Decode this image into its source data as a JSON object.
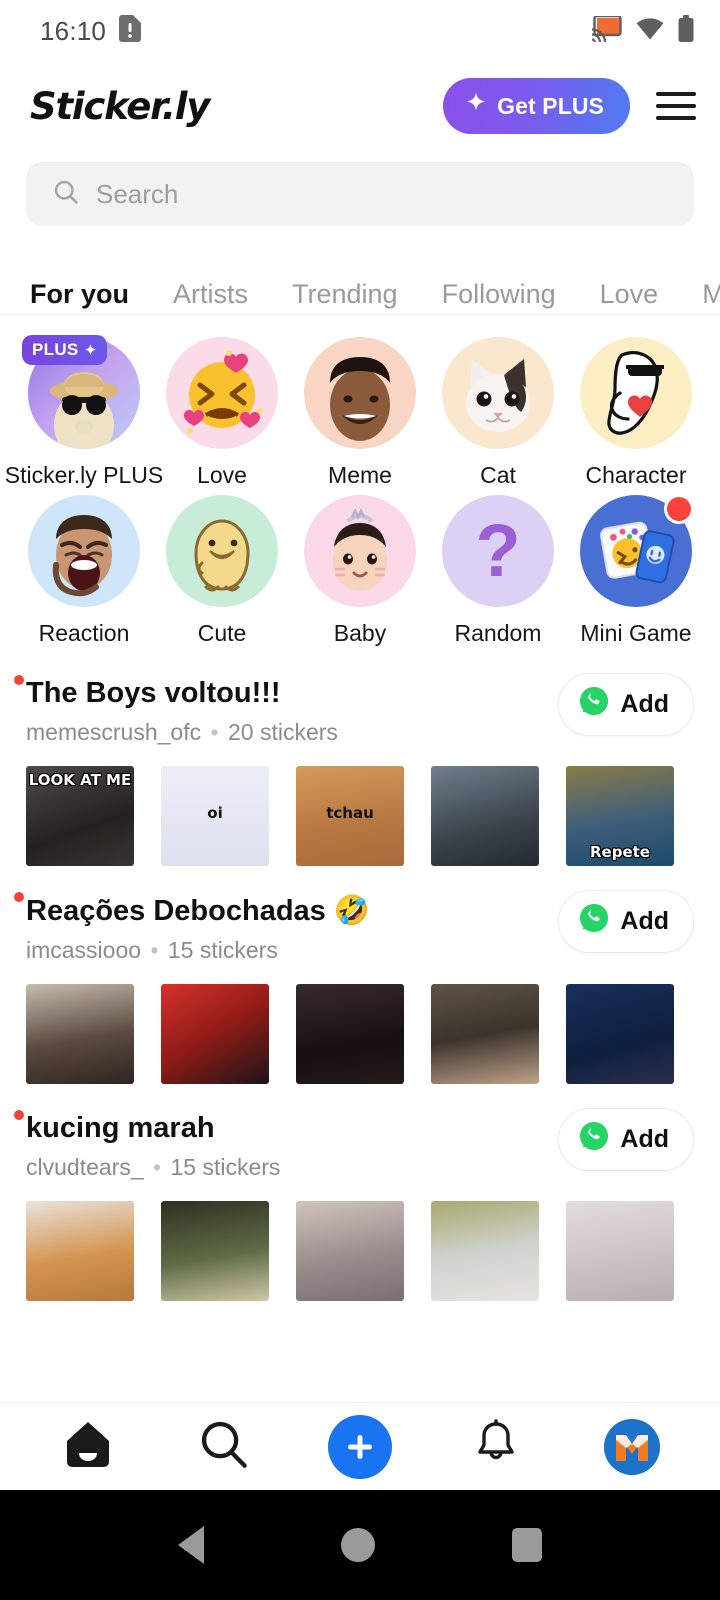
{
  "status_bar": {
    "time": "16:10",
    "icons": [
      "sim-alert-icon",
      "cast-icon",
      "wifi-icon",
      "battery-icon"
    ]
  },
  "header": {
    "brand": "Sticker.ly",
    "plus_button_label": "Get PLUS",
    "menu_icon": "hamburger-menu-icon"
  },
  "search": {
    "placeholder": "Search",
    "value": "",
    "icon": "search-icon"
  },
  "tabs": [
    {
      "label": "For you",
      "active": true
    },
    {
      "label": "Artists",
      "active": false
    },
    {
      "label": "Trending",
      "active": false
    },
    {
      "label": "Following",
      "active": false
    },
    {
      "label": "Love",
      "active": false
    },
    {
      "label": "Mem",
      "active": false
    }
  ],
  "categories": [
    {
      "label": "Sticker.ly PLUS",
      "badge": "PLUS",
      "bg": "#b9a4ef",
      "icon": "dog-sunglasses-hat-icon"
    },
    {
      "label": "Love",
      "bg": "#fbdbe8",
      "icon": "smiling-hearts-emoji",
      "glyph": "😖"
    },
    {
      "label": "Meme",
      "bg": "#f9d6c4",
      "icon": "smiling-man-meme-icon"
    },
    {
      "label": "Cat",
      "bg": "#fbe6ce",
      "icon": "cat-face-icon"
    },
    {
      "label": "Character",
      "bg": "#fbeec2",
      "icon": "flork-heart-character-icon"
    },
    {
      "label": "Reaction",
      "bg": "#cfe6fa",
      "icon": "screaming-man-icon"
    },
    {
      "label": "Cute",
      "bg": "#c7edd8",
      "icon": "duck-character-icon"
    },
    {
      "label": "Baby",
      "bg": "#fbd8e6",
      "icon": "baby-face-icon"
    },
    {
      "label": "Random",
      "bg": "#ddd0f5",
      "icon": "question-mark-icon",
      "glyph": "?"
    },
    {
      "label": "Mini Game",
      "bg": "#4a6fd4",
      "icon": "mini-game-cards-icon",
      "notification": true
    }
  ],
  "packs": [
    {
      "title": "The Boys voltou!!!",
      "emoji": "",
      "author": "memescrush_ofc",
      "count": "20 stickers",
      "separator": "•",
      "add_label": "Add",
      "add_icon": "whatsapp-icon",
      "is_new": true,
      "thumbs": [
        {
          "caption": "LOOK AT ME",
          "caption_pos": "top",
          "bg": "linear-gradient(160deg,#4d4b47,#232221 60%,#3a3430)"
        },
        {
          "caption": "oi",
          "caption_pos": "mid",
          "bg": "linear-gradient(180deg,#eceef7,#dde1ef)"
        },
        {
          "caption": "tchau",
          "caption_pos": "mid",
          "bg": "linear-gradient(170deg,#d79a5c,#b87a42 55%,#a9683a)"
        },
        {
          "caption": "",
          "caption_pos": "top",
          "bg": "linear-gradient(165deg,#6f7f8d,#3c434b 60%,#232a31)"
        },
        {
          "caption": "Repete",
          "caption_pos": "bot",
          "bg": "linear-gradient(170deg,#8a7c46,#3e5e7a 55%,#1d4a6b)"
        }
      ]
    },
    {
      "title": "Reações Debochadas",
      "emoji": "🤣",
      "author": "imcassiooo",
      "count": "15 stickers",
      "separator": "•",
      "add_label": "Add",
      "add_icon": "whatsapp-icon",
      "is_new": true,
      "thumbs": [
        {
          "caption": "",
          "caption_pos": "top",
          "bg": "linear-gradient(170deg,#c6bcae,#5b4a3f 55%,#2e2622)"
        },
        {
          "caption": "",
          "caption_pos": "top",
          "bg": "linear-gradient(150deg,#d8312a,#8e1b16 50%,#1d1517)"
        },
        {
          "caption": "",
          "caption_pos": "top",
          "bg": "linear-gradient(170deg,#3a2a2c,#17100f 60%,#241a1a)"
        },
        {
          "caption": "",
          "caption_pos": "top",
          "bg": "linear-gradient(170deg,#5f5445,#3b332c 50%,#bda389)"
        },
        {
          "caption": "",
          "caption_pos": "top",
          "bg": "linear-gradient(165deg,#17305c,#0f1f3f 60%,#2a2f4d)"
        }
      ]
    },
    {
      "title": "kucing marah",
      "emoji": "",
      "author": "clvudtears_",
      "count": "15 stickers",
      "separator": "•",
      "add_label": "Add",
      "add_icon": "whatsapp-icon",
      "is_new": true,
      "thumbs": [
        {
          "caption": "",
          "caption_pos": "top",
          "bg": "linear-gradient(170deg,#e9e2db,#d49551 55%,#b7793c)"
        },
        {
          "caption": "",
          "caption_pos": "top",
          "bg": "linear-gradient(170deg,#2b3123,#5f6b46 55%,#cfc7a8)"
        },
        {
          "caption": "",
          "caption_pos": "top",
          "bg": "linear-gradient(170deg,#cfc4c0,#9a8d8c 55%,#7a6f70)"
        },
        {
          "caption": "",
          "caption_pos": "top",
          "bg": "linear-gradient(170deg,#a8a86e,#cfd2cc 50%,#e6e4e0)"
        },
        {
          "caption": "",
          "caption_pos": "top",
          "bg": "linear-gradient(170deg,#e2dcdc,#cdc3c5 55%,#b9aeb1)"
        }
      ]
    }
  ],
  "bottom_nav": [
    {
      "name": "home",
      "icon": "home-icon",
      "active": true
    },
    {
      "name": "search",
      "icon": "search-icon",
      "active": false
    },
    {
      "name": "create",
      "icon": "plus-icon",
      "active": false
    },
    {
      "name": "notifications",
      "icon": "bell-icon",
      "active": false
    },
    {
      "name": "profile",
      "icon": "avatar-icon",
      "active": false
    }
  ],
  "system_nav": [
    {
      "name": "back",
      "icon": "triangle-back-icon"
    },
    {
      "name": "home",
      "icon": "circle-home-icon"
    },
    {
      "name": "recents",
      "icon": "square-recents-icon"
    }
  ],
  "colors": {
    "accent_blue": "#1a73f0",
    "plus_gradient_start": "#8a4fe8",
    "plus_gradient_end": "#4f7bf0",
    "whatsapp_green": "#25d366",
    "new_dot_red": "#f14336",
    "badge_red": "#f8443c"
  }
}
